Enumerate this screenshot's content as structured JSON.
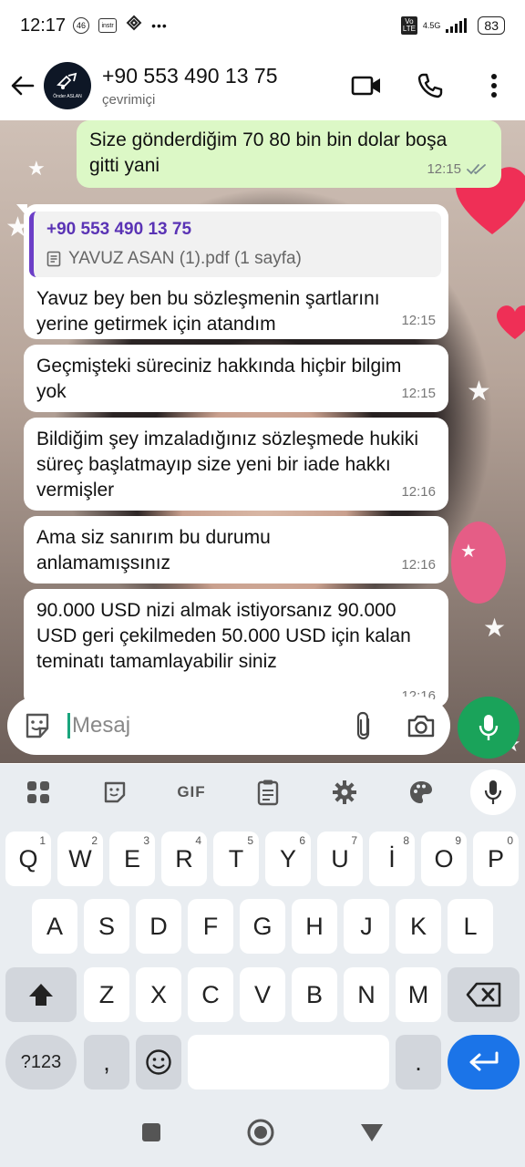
{
  "status_bar": {
    "time": "12:17",
    "badge_46": "46",
    "badge_app": "instr",
    "more": "•••",
    "volte": "Vo LTE",
    "network": "4.5G",
    "battery": "83"
  },
  "header": {
    "contact_name": "+90 553 490 13 75",
    "contact_status": "çevrimiçi",
    "avatar_text": "Önder ASLAN"
  },
  "messages": [
    {
      "dir": "out",
      "text": "Size gönderdiğim 70 80 bin bin dolar boşa gitti yani",
      "time": "12:15"
    },
    {
      "dir": "in",
      "quote_name": "+90 553 490 13 75",
      "quote_file": "YAVUZ ASAN (1).pdf (1 sayfa)",
      "text": "Yavuz bey ben bu sözleşmenin şartlarını yerine getirmek için  atandım",
      "time": "12:15"
    },
    {
      "dir": "in",
      "text": "Geçmişteki süreciniz hakkında hiçbir bilgim yok",
      "time": "12:15"
    },
    {
      "dir": "in",
      "text": "Bildiğim şey imzaladığınız sözleşmede hukiki süreç başlatmayıp size yeni bir iade hakkı vermişler",
      "time": "12:16"
    },
    {
      "dir": "in",
      "text": "Ama siz sanırım bu durumu anlamamışsınız",
      "time": "12:16"
    },
    {
      "dir": "in",
      "text": "90.000 USD nizi almak istiyorsanız 90.000 USD geri çekilmeden 50.000 USD için kalan teminatı tamamlayabilir siniz",
      "time": "12:16"
    }
  ],
  "input": {
    "placeholder": "Mesaj"
  },
  "keyboard": {
    "toolbar_gif": "GIF",
    "row1": [
      {
        "k": "Q",
        "s": "1"
      },
      {
        "k": "W",
        "s": "2"
      },
      {
        "k": "E",
        "s": "3"
      },
      {
        "k": "R",
        "s": "4"
      },
      {
        "k": "T",
        "s": "5"
      },
      {
        "k": "Y",
        "s": "6"
      },
      {
        "k": "U",
        "s": "7"
      },
      {
        "k": "İ",
        "s": "8"
      },
      {
        "k": "O",
        "s": "9"
      },
      {
        "k": "P",
        "s": "0"
      }
    ],
    "row2": [
      "A",
      "S",
      "D",
      "F",
      "G",
      "H",
      "J",
      "K",
      "L"
    ],
    "row3": [
      "Z",
      "X",
      "C",
      "V",
      "B",
      "N",
      "M"
    ],
    "num_label": "?123",
    "comma": ",",
    "period": "."
  },
  "colors": {
    "outgoing_bubble": "#dcf8c6",
    "incoming_bubble": "#ffffff",
    "mic_button": "#1aa35a",
    "enter_key": "#1b74e8",
    "quote_accent": "#6c3fc7"
  }
}
